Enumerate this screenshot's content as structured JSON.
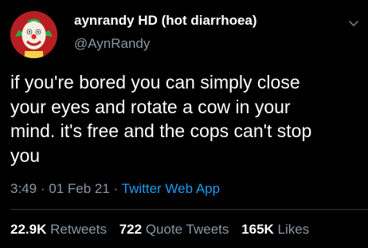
{
  "tweet": {
    "author": {
      "display_name": "aynrandy HD (hot diarrhoea)",
      "handle": "@AynRandy",
      "avatar_icon": "krusty-clown-avatar"
    },
    "menu_icon": "chevron-down-icon",
    "text_lines": [
      "if you're bored you can simply close",
      "your eyes and rotate a cow in your",
      "mind. it's free and the cops can't stop",
      "you"
    ],
    "time": "3:49",
    "separator": "·",
    "date": "01 Feb 21",
    "source": "Twitter Web App",
    "stats": {
      "retweets": {
        "count": "22.9K",
        "label": "Retweets"
      },
      "quote_tweets": {
        "count": "722",
        "label": "Quote Tweets"
      },
      "likes": {
        "count": "165K",
        "label": "Likes"
      }
    }
  },
  "colors": {
    "background": "#000000",
    "text": "#ffffff",
    "secondary": "#8b98a5",
    "link": "#1d9bf0",
    "divider": "#2f3336"
  }
}
